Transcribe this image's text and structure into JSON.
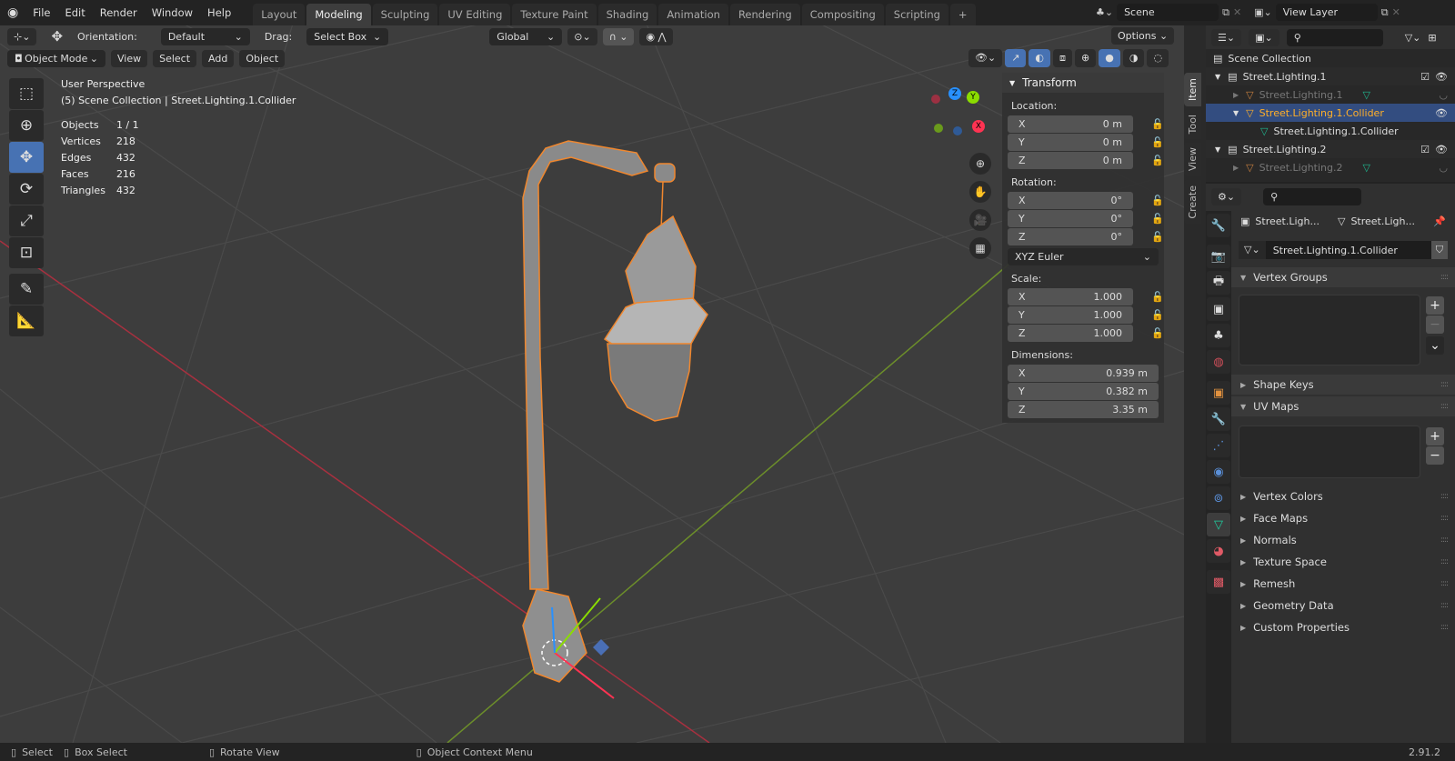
{
  "topbar": {
    "menus": [
      "File",
      "Edit",
      "Render",
      "Window",
      "Help"
    ],
    "workspaces": [
      "Layout",
      "Modeling",
      "Sculpting",
      "UV Editing",
      "Texture Paint",
      "Shading",
      "Animation",
      "Rendering",
      "Compositing",
      "Scripting"
    ],
    "active_workspace": "Modeling",
    "add_tab": "+",
    "scene": "Scene",
    "view_layer": "View Layer"
  },
  "tool_header": {
    "orientation_label": "Orientation:",
    "orientation_value": "Default",
    "drag_label": "Drag:",
    "drag_value": "Select Box",
    "transform_orientation": "Global",
    "options": "Options"
  },
  "view_header": {
    "mode": "Object Mode",
    "menus": [
      "View",
      "Select",
      "Add",
      "Object"
    ]
  },
  "overlay": {
    "perspective": "User Perspective",
    "context": "(5) Scene Collection | Street.Lighting.1.Collider",
    "stats": [
      {
        "label": "Objects",
        "value": "1 / 1"
      },
      {
        "label": "Vertices",
        "value": "218"
      },
      {
        "label": "Edges",
        "value": "432"
      },
      {
        "label": "Faces",
        "value": "216"
      },
      {
        "label": "Triangles",
        "value": "432"
      }
    ]
  },
  "gizmo": {
    "x": "X",
    "y": "Y",
    "z": "Z"
  },
  "npanel": {
    "title": "Transform",
    "location_label": "Location:",
    "location": [
      {
        "axis": "X",
        "value": "0 m"
      },
      {
        "axis": "Y",
        "value": "0 m"
      },
      {
        "axis": "Z",
        "value": "0 m"
      }
    ],
    "rotation_label": "Rotation:",
    "rotation": [
      {
        "axis": "X",
        "value": "0°"
      },
      {
        "axis": "Y",
        "value": "0°"
      },
      {
        "axis": "Z",
        "value": "0°"
      }
    ],
    "rotation_mode": "XYZ Euler",
    "scale_label": "Scale:",
    "scale": [
      {
        "axis": "X",
        "value": "1.000"
      },
      {
        "axis": "Y",
        "value": "1.000"
      },
      {
        "axis": "Z",
        "value": "1.000"
      }
    ],
    "dimensions_label": "Dimensions:",
    "dimensions": [
      {
        "axis": "X",
        "value": "0.939 m"
      },
      {
        "axis": "Y",
        "value": "0.382 m"
      },
      {
        "axis": "Z",
        "value": "3.35 m"
      }
    ],
    "tabs": [
      "Item",
      "Tool",
      "View",
      "Create"
    ]
  },
  "outliner": {
    "root": "Scene Collection",
    "rows": [
      "Street.Lighting.1",
      "Street.Lighting.1",
      "Street.Lighting.1.Collider",
      "Street.Lighting.1.Collider",
      "Street.Lighting.2",
      "Street.Lighting.2"
    ]
  },
  "properties": {
    "breadcrumb_object": "Street.Ligh...",
    "breadcrumb_data": "Street.Ligh...",
    "mesh_name": "Street.Lighting.1.Collider",
    "sections": [
      "Vertex Groups",
      "Shape Keys",
      "UV Maps",
      "Vertex Colors",
      "Face Maps",
      "Normals",
      "Texture Space",
      "Remesh",
      "Geometry Data",
      "Custom Properties"
    ]
  },
  "status": {
    "select": "Select",
    "box_select": "Box Select",
    "rotate_view": "Rotate View",
    "context_menu": "Object Context Menu",
    "version": "2.91.2"
  },
  "colors": {
    "accent": "#4772b3",
    "selected": "#ffaf29",
    "x_axis": "#ff3352",
    "y_axis": "#8bdc00",
    "z_axis": "#2890ff"
  }
}
